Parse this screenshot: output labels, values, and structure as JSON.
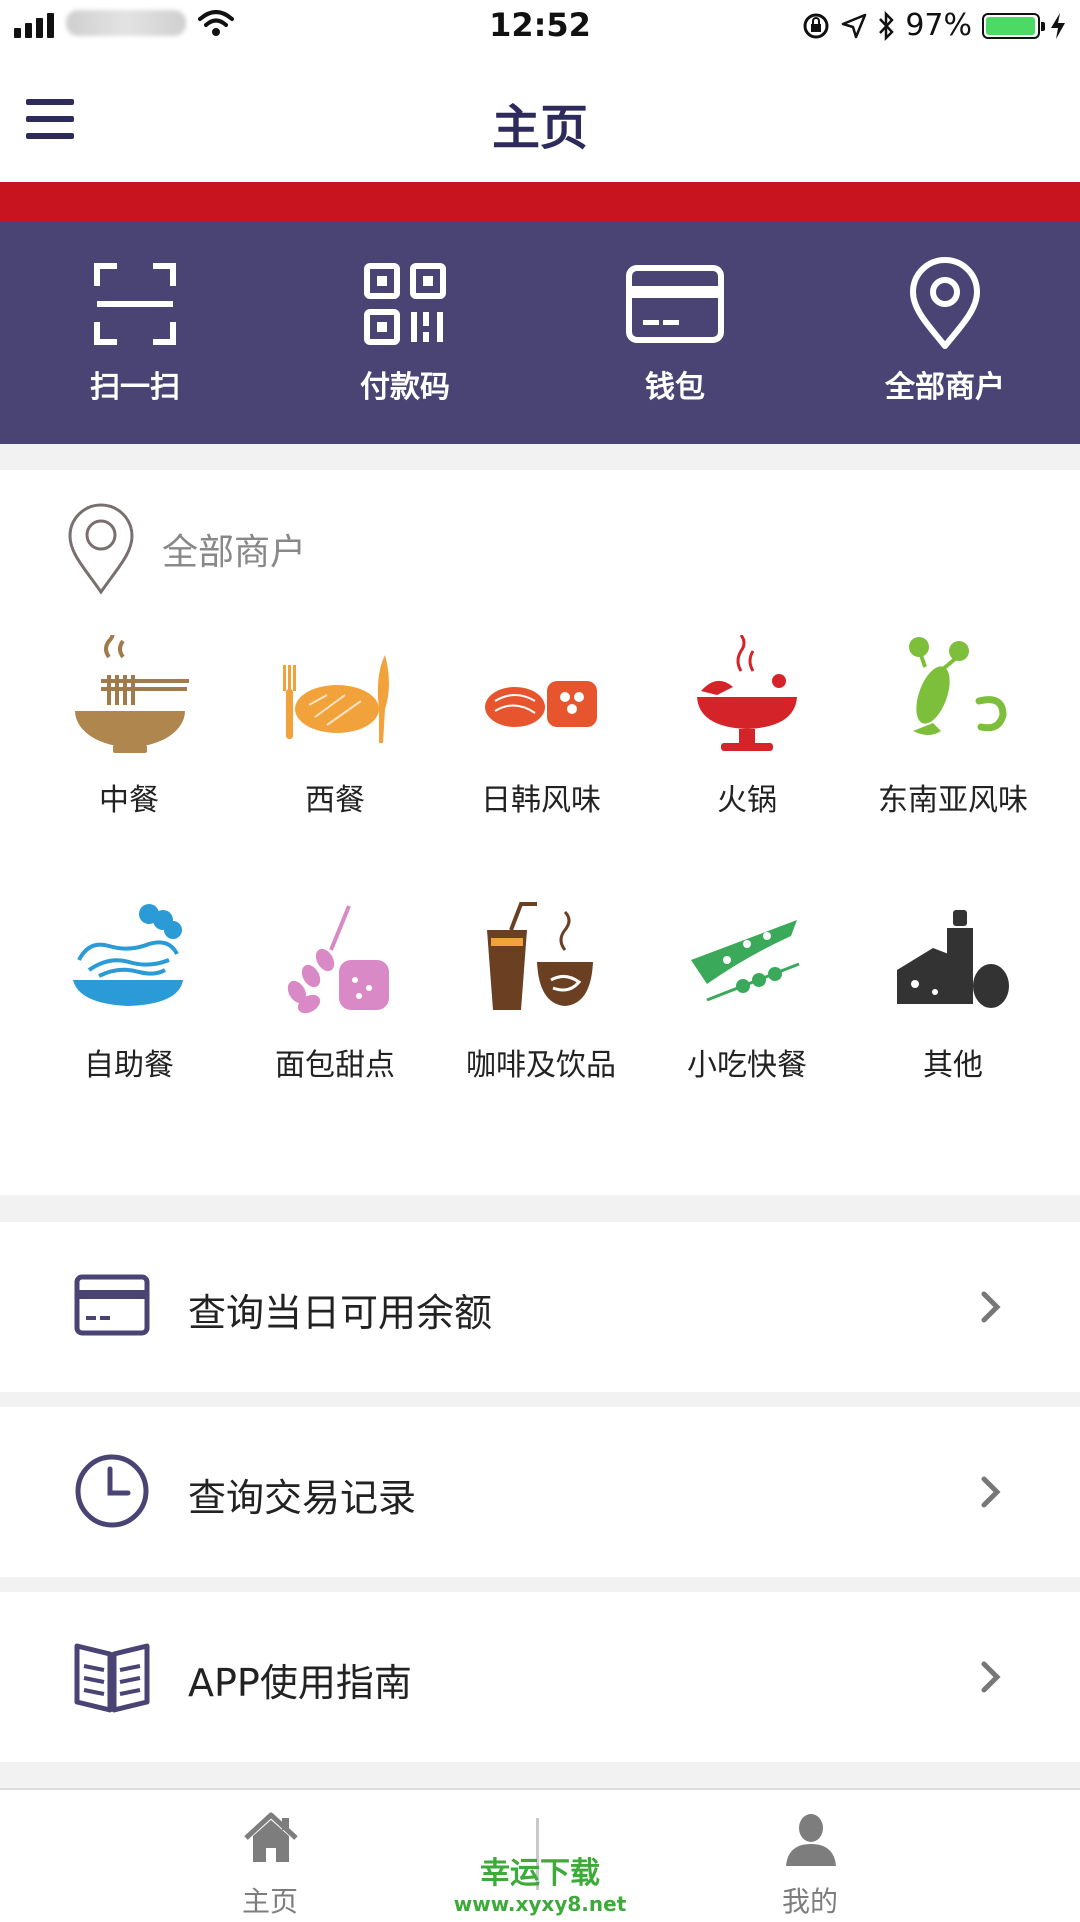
{
  "status_bar": {
    "time": "12:52",
    "battery_percent": "97%",
    "battery_level": 0.97,
    "colors": {
      "battery_fill": "#4cd964"
    }
  },
  "header": {
    "title": "主页",
    "menu_icon": "hamburger-icon"
  },
  "theme": {
    "brand_purple": "#4a4475",
    "brand_red": "#c8141f",
    "title_color": "#2d2b5c"
  },
  "quick_actions": [
    {
      "label": "扫一扫",
      "icon": "scan-icon"
    },
    {
      "label": "付款码",
      "icon": "qr-code-icon"
    },
    {
      "label": "钱包",
      "icon": "wallet-card-icon"
    },
    {
      "label": "全部商户",
      "icon": "location-pin-icon"
    }
  ],
  "merchants": {
    "heading": "全部商户",
    "heading_icon": "location-pin-icon",
    "categories": [
      {
        "label": "中餐",
        "icon": "noodle-bowl-icon"
      },
      {
        "label": "西餐",
        "icon": "steak-cutlery-icon"
      },
      {
        "label": "日韩风味",
        "icon": "sushi-icon"
      },
      {
        "label": "火锅",
        "icon": "hotpot-icon"
      },
      {
        "label": "东南亚风味",
        "icon": "lobster-shrimp-icon"
      },
      {
        "label": "自助餐",
        "icon": "buffet-plate-icon"
      },
      {
        "label": "面包甜点",
        "icon": "bread-wheat-icon"
      },
      {
        "label": "咖啡及饮品",
        "icon": "coffee-drink-icon"
      },
      {
        "label": "小吃快餐",
        "icon": "pizza-skewer-icon"
      },
      {
        "label": "其他",
        "icon": "cheese-bottle-icon"
      }
    ]
  },
  "menu_items": [
    {
      "label": "查询当日可用余额",
      "icon": "card-icon"
    },
    {
      "label": "查询交易记录",
      "icon": "clock-icon"
    },
    {
      "label": "APP使用指南",
      "icon": "book-icon"
    }
  ],
  "tab_bar": {
    "tabs": [
      {
        "label": "主页",
        "icon": "home-icon"
      },
      {
        "label": "我的",
        "icon": "user-icon"
      }
    ]
  },
  "watermark": {
    "line1": "幸运下载",
    "line2": "www.xyxy8.net"
  }
}
